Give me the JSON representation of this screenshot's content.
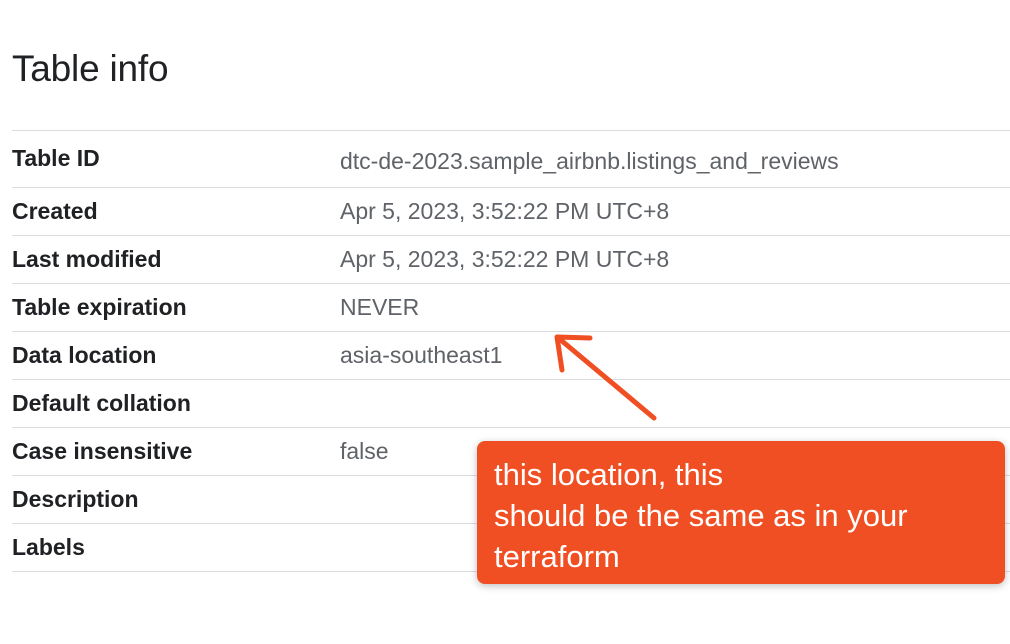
{
  "page": {
    "title": "Table info"
  },
  "table": {
    "rows": [
      {
        "label": "Table ID",
        "value": "dtc-de-2023.sample_airbnb.listings_and_reviews"
      },
      {
        "label": "Created",
        "value": "Apr 5, 2023, 3:52:22 PM UTC+8"
      },
      {
        "label": "Last modified",
        "value": "Apr 5, 2023, 3:52:22 PM UTC+8"
      },
      {
        "label": "Table expiration",
        "value": "NEVER"
      },
      {
        "label": "Data location",
        "value": "asia-southeast1"
      },
      {
        "label": "Default collation",
        "value": ""
      },
      {
        "label": "Case insensitive",
        "value": "false"
      },
      {
        "label": "Description",
        "value": ""
      },
      {
        "label": "Labels",
        "value": ""
      }
    ]
  },
  "annotation": {
    "text": "this location, this\nshould be the same as in your\nterraform",
    "color": "#f04e23",
    "arrow_icon": "arrow-icon"
  }
}
